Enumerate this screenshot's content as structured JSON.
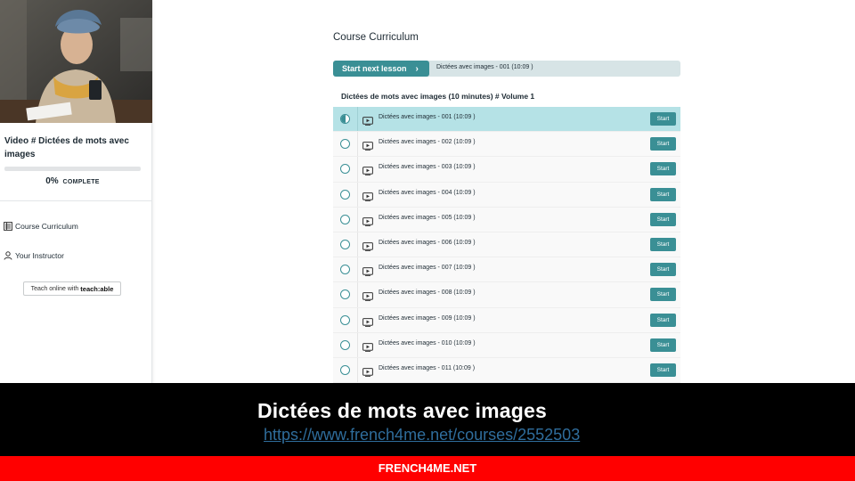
{
  "sidebar": {
    "course_title": "Video # Dictées de mots avec images",
    "progress_percent": 0,
    "progress_value": "0%",
    "progress_label": "COMPLETE",
    "nav": [
      {
        "label": "Course Curriculum",
        "icon": "curriculum-icon"
      },
      {
        "label": "Your Instructor",
        "icon": "person-icon"
      }
    ],
    "teach_badge": {
      "prefix": "Teach online with",
      "brand": "teach:able"
    }
  },
  "main": {
    "title": "Course Curriculum",
    "next_button_label": "Start next lesson",
    "next_lesson_title": "Dictées avec images - 001 (10:09 )",
    "section_title": "Dictées de mots avec images (10 minutes) # Volume 1",
    "start_label": "Start",
    "lessons": [
      {
        "title": "Dictées avec images - 001 (10:09 )",
        "status": "in-progress"
      },
      {
        "title": "Dictées avec images - 002 (10:09 )",
        "status": "not-started"
      },
      {
        "title": "Dictées avec images - 003 (10:09 )",
        "status": "not-started"
      },
      {
        "title": "Dictées avec images - 004 (10:09 )",
        "status": "not-started"
      },
      {
        "title": "Dictées avec images - 005 (10:09 )",
        "status": "not-started"
      },
      {
        "title": "Dictées avec images - 006 (10:09 )",
        "status": "not-started"
      },
      {
        "title": "Dictées avec images - 007 (10:09 )",
        "status": "not-started"
      },
      {
        "title": "Dictées avec images - 008 (10:09 )",
        "status": "not-started"
      },
      {
        "title": "Dictées avec images - 009 (10:09 )",
        "status": "not-started"
      },
      {
        "title": "Dictées avec images - 010 (10:09 )",
        "status": "not-started"
      },
      {
        "title": "Dictées avec images - 011 (10:09 )",
        "status": "not-started"
      }
    ]
  },
  "banner": {
    "title": "Dictées de mots avec images",
    "link": "https://www.french4me.net/courses/2552503",
    "footer": "FRENCH4ME.NET"
  },
  "colors": {
    "accent": "#3a8f95",
    "active_row": "#b5e2e6",
    "banner_black": "#000000",
    "banner_red": "#ff0000"
  }
}
